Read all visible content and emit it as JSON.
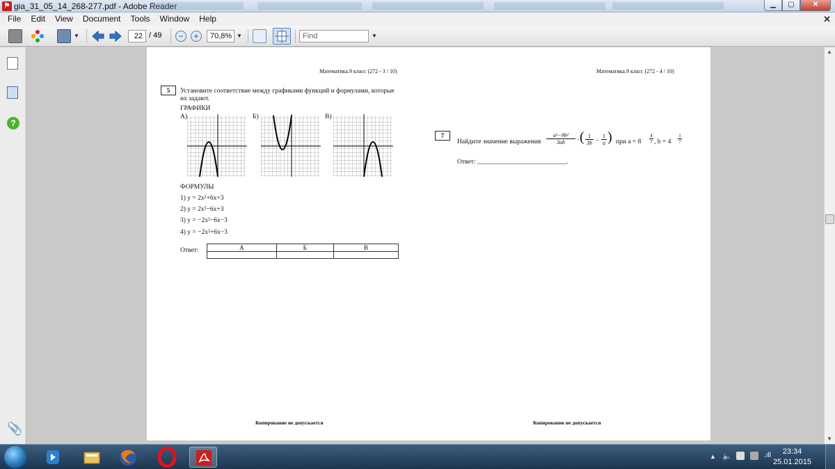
{
  "window": {
    "title": "gia_31_05_14_268-277.pdf - Adobe Reader"
  },
  "menu": {
    "items": [
      "File",
      "Edit",
      "View",
      "Document",
      "Tools",
      "Window",
      "Help"
    ]
  },
  "toolbar": {
    "page_current": "22",
    "page_total": "/ 49",
    "zoom": "70,8%",
    "find_placeholder": "Find"
  },
  "page_left": {
    "header": "Математика.9 класс (272 - 3 / 10)",
    "q5_number": "5",
    "q5_line1": "Установите соответствие между графиками функций и формулами, которые",
    "q5_line2": "их задают.",
    "graphs_label": "ГРАФИКИ",
    "graph_labels": [
      "А)",
      "Б)",
      "В)"
    ],
    "formulas_label": "ФОРМУЛЫ",
    "formulas": [
      "1)  y = 2x²+6x+3",
      "2)  y = 2x²−6x+3",
      "3)  y = −2x²−6x−3",
      "4)  y = −2x²+6x−3"
    ],
    "answer_label": "Ответ:",
    "answer_cols": [
      "А",
      "Б",
      "В"
    ],
    "footer": "Копирование не допускается"
  },
  "page_right": {
    "header": "Математика.9 класс (272 - 4 / 10)",
    "q7_number": "7",
    "q7_text": "Найдите значение выражения",
    "expr_num": "a²−9b²",
    "expr_den": "3ab",
    "expr_mid": "·",
    "frac1_num": "1",
    "frac1_den": "3b",
    "frac_minus": "−",
    "frac2_num": "1",
    "frac2_den": "a",
    "q7_when": "при a = 8",
    "a_num": "4",
    "a_den": "7",
    "q7_b": ", b = 4",
    "b_num": "1",
    "b_den": "7",
    "answer_label": "Ответ: ___________________________.",
    "footer": "Копирование не допускается"
  },
  "taskbar": {
    "time": "23:34",
    "date": "25.01.2015"
  },
  "colors": {
    "accent": "#c8201d",
    "taskbar": "#1c3550"
  }
}
